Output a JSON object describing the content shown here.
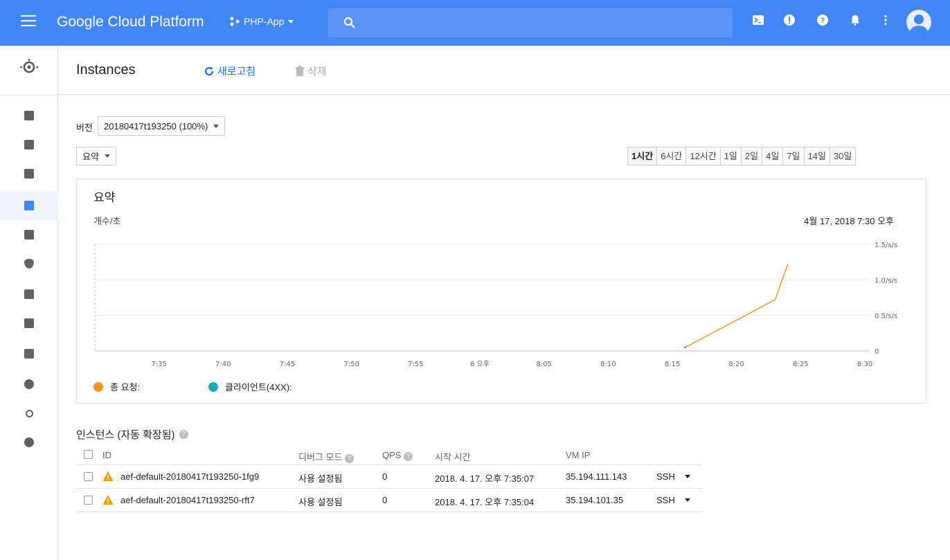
{
  "topbar": {
    "brand": "Google Cloud Platform",
    "project": "PHP-App",
    "icons": [
      "cloud-shell-icon",
      "feedback-icon",
      "help-icon",
      "notifications-icon",
      "more-icon",
      "account-icon"
    ]
  },
  "header": {
    "title": "Instances",
    "refresh_label": "새로고침",
    "delete_label": "삭제"
  },
  "filters": {
    "version_label": "버전",
    "version_value": "20180417t193250 (100%)",
    "view_value": "요약",
    "time_ranges": [
      "1시간",
      "6시간",
      "12시간",
      "1일",
      "2일",
      "4일",
      "7일",
      "14일",
      "30일"
    ],
    "selected_range": "1시간"
  },
  "chart_card": {
    "title": "요약",
    "unit": "개수/초",
    "timestamp": "4월 17, 2018 7:30 오후",
    "legend": [
      {
        "label": "총 요청:",
        "color": "#f4952c"
      },
      {
        "label": "클라이언트(4XX):",
        "color": "#1ba9bd"
      }
    ]
  },
  "chart_data": {
    "type": "line",
    "x_ticks": [
      "7:35",
      "7:40",
      "7:45",
      "7:50",
      "7:55",
      "8 오후",
      "8:05",
      "8:10",
      "8:15",
      "8:20",
      "8:25",
      "8:30"
    ],
    "y_ticks": [
      "1.5/s/s",
      "1.0/s/s",
      "0.5/s/s",
      "0"
    ],
    "ylim": [
      0,
      1.5
    ],
    "series": [
      {
        "name": "총 요청:",
        "color": "#f4952c",
        "x": [
          "8:16",
          "8:23",
          "8:24"
        ],
        "values": [
          0.05,
          0.72,
          1.22
        ]
      },
      {
        "name": "클라이언트(4XX):",
        "color": "#1ba9bd",
        "x": [
          "8:16"
        ],
        "values": [
          0.05
        ]
      }
    ],
    "grid": true
  },
  "instances": {
    "title": "인스턴스 (자동 확장됨)",
    "columns": [
      "ID",
      "디버그 모드",
      "QPS",
      "시작 시간",
      "VM IP"
    ],
    "rows": [
      {
        "id": "aef-default-20180417t193250-1fg9",
        "debug": "사용 설정됨",
        "qps": "0",
        "start": "2018. 4. 17. 오후 7:35:07",
        "ip": "35.194.111.143",
        "ssh": "SSH"
      },
      {
        "id": "aef-default-20180417t193250-rft7",
        "debug": "사용 설정됨",
        "qps": "0",
        "start": "2018. 4. 17. 오후 7:35:04",
        "ip": "35.194.101.35",
        "ssh": "SSH"
      }
    ]
  }
}
